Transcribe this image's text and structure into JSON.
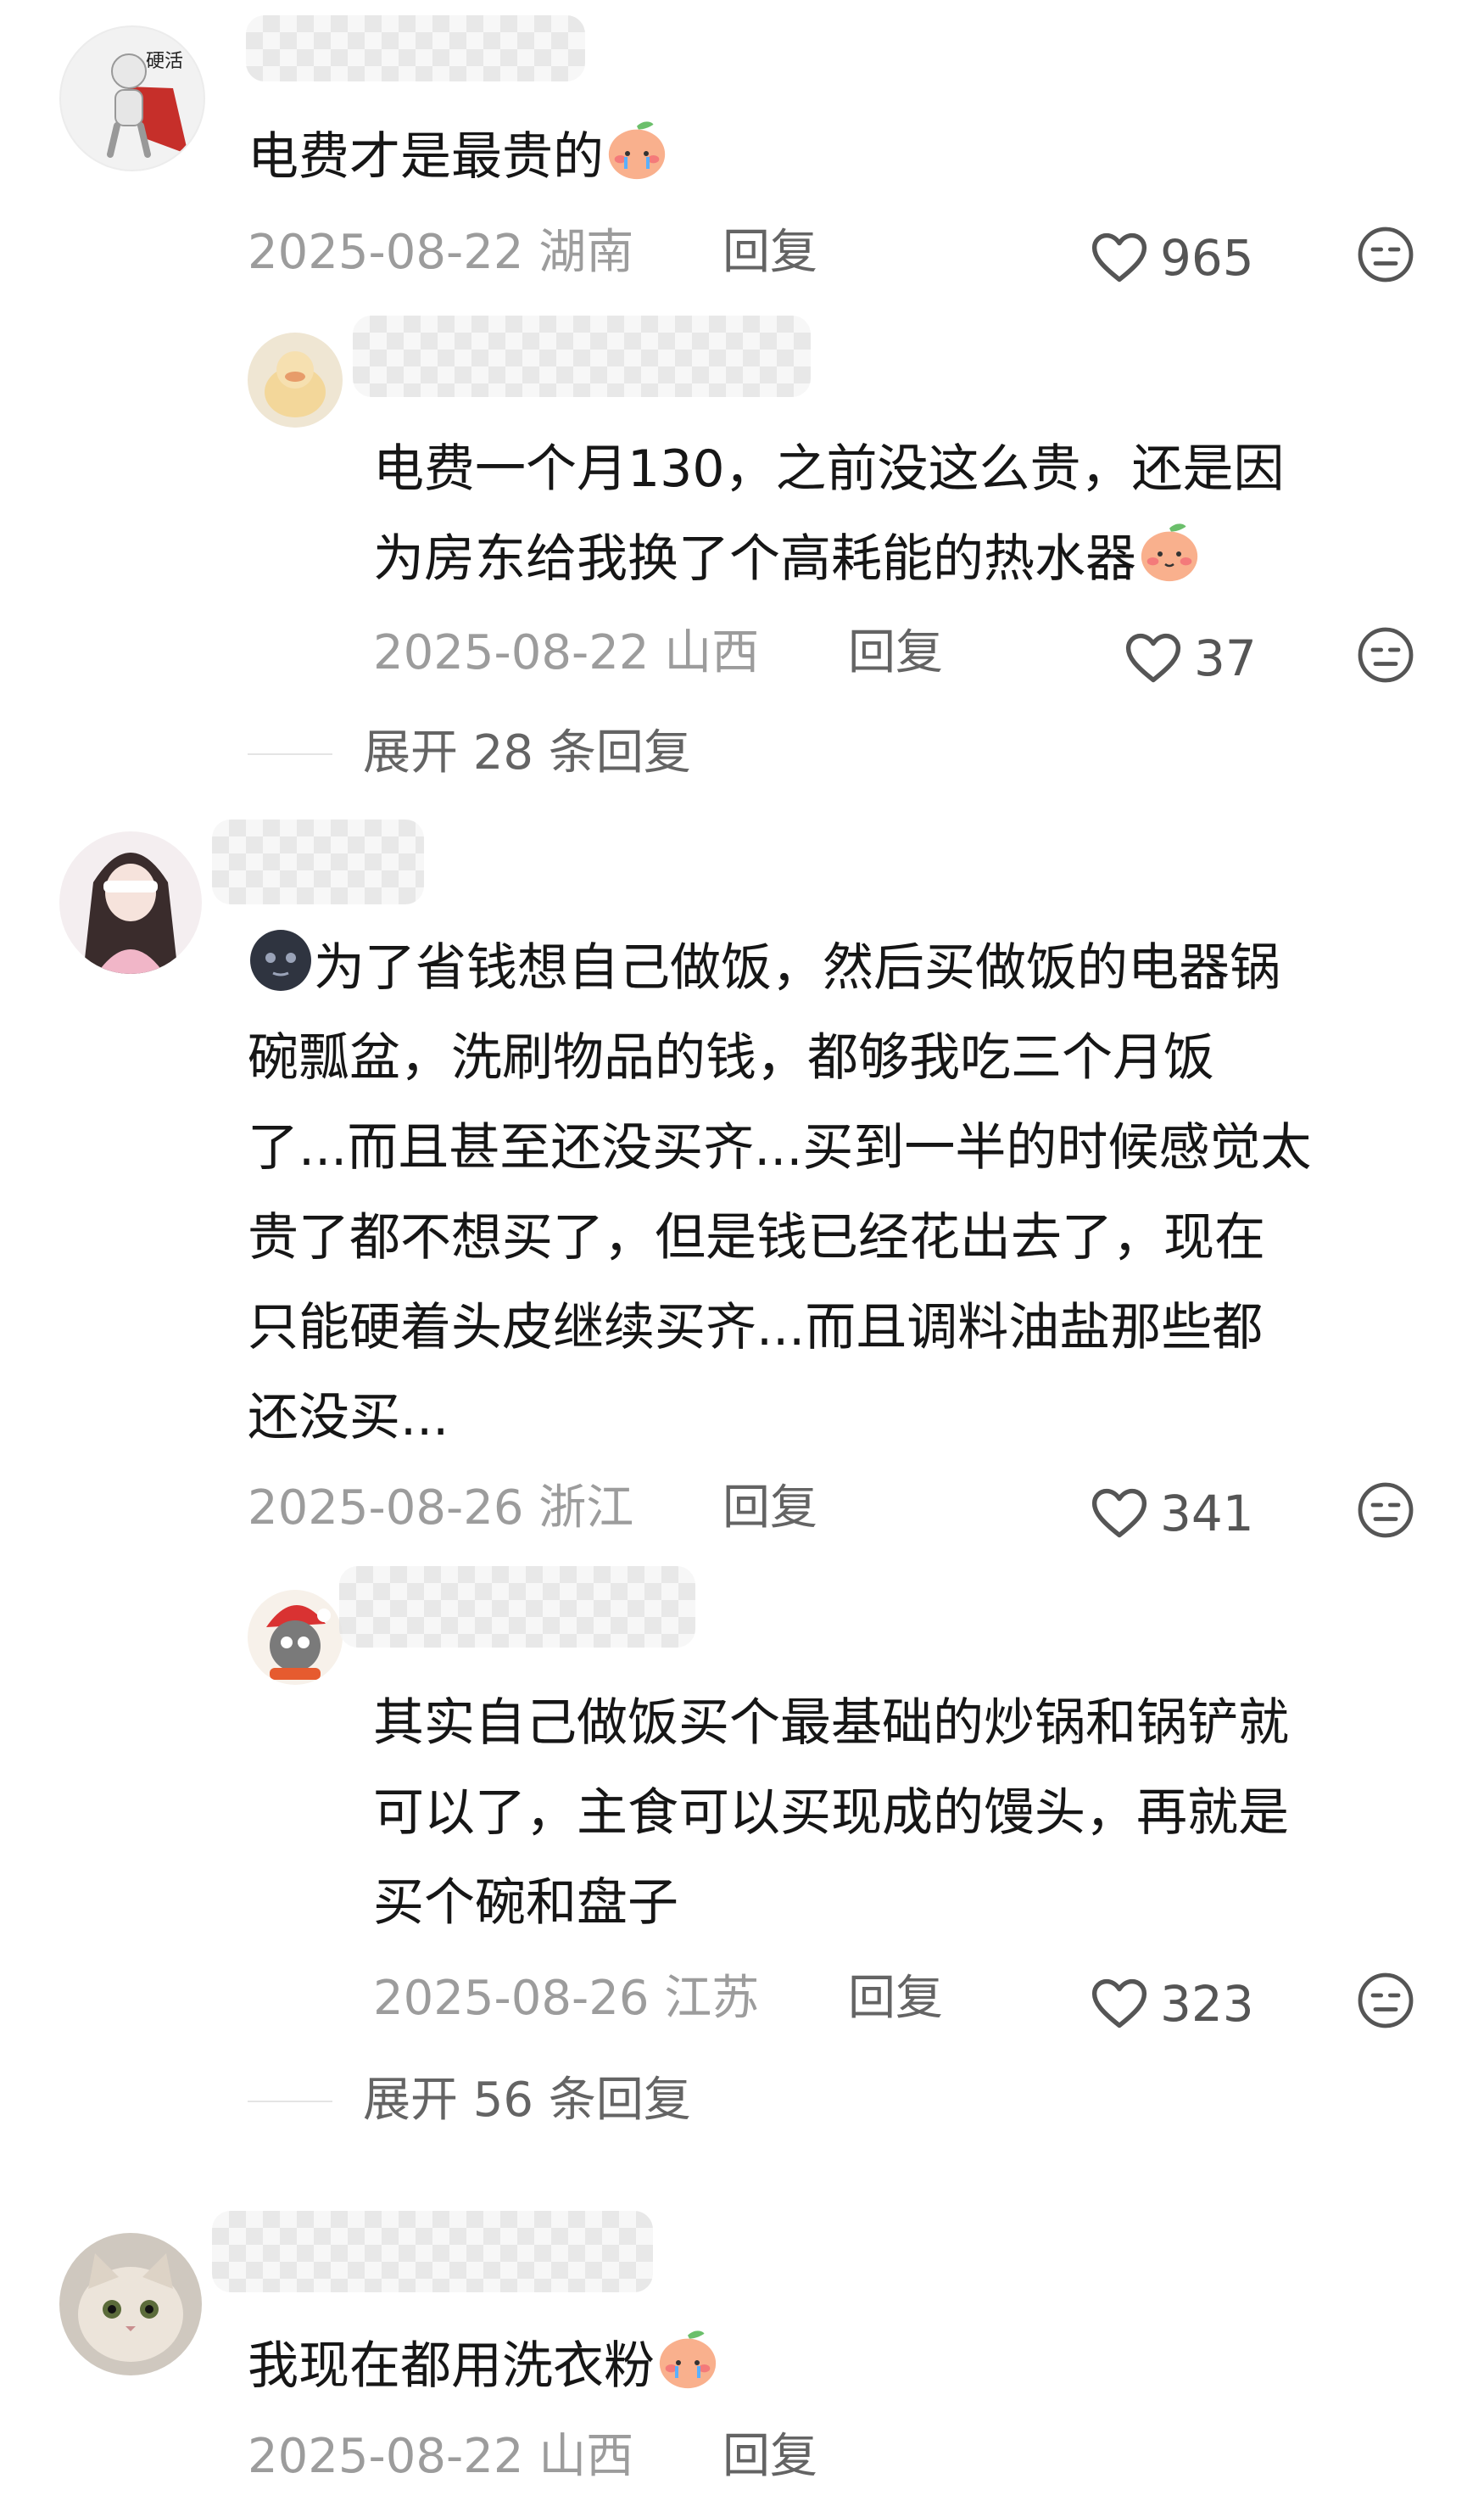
{
  "comments": [
    {
      "text": "电费才是最贵的",
      "date": "2025-08-22",
      "location": "湖南",
      "reply_label": "回复",
      "likes": "965",
      "avatar_text": "硬活",
      "reply": {
        "text_line1": "电费一个月130，之前没这么贵，还是因",
        "text_line2": "为房东给我换了个高耗能的热水器",
        "date": "2025-08-22",
        "location": "山西",
        "reply_label": "回复",
        "likes": "37"
      },
      "expand_label": "展开 28 条回复"
    },
    {
      "lines": [
        "为了省钱想自己做饭，然后买做饭的电器锅",
        "碗瓢盆，洗刷物品的钱，都够我吃三个月饭",
        "了...而且甚至还没买齐...买到一半的时候感觉太",
        "贵了都不想买了，但是钱已经花出去了，现在",
        "只能硬着头皮继续买齐...而且调料油盐那些都",
        "还没买..."
      ],
      "date": "2025-08-26",
      "location": "浙江",
      "reply_label": "回复",
      "likes": "341",
      "reply": {
        "lines": [
          "其实自己做饭买个最基础的炒锅和锅铲就",
          "可以了，主食可以买现成的馒头，再就是",
          "买个碗和盘子"
        ],
        "date": "2025-08-26",
        "location": "江苏",
        "reply_label": "回复",
        "likes": "323"
      },
      "expand_label": "展开 56 条回复"
    },
    {
      "text": "我现在都用洗衣粉",
      "date": "2025-08-22",
      "location": "山西",
      "reply_label": "回复"
    }
  ],
  "icons": {
    "like": "heart-outline-icon",
    "dislike": "meh-face-icon",
    "cry_emoji": "crying-peach-emoji",
    "shy_emoji": "blushing-peach-emoji",
    "moon_emoji": "dark-moon-face-emoji"
  },
  "colors": {
    "text": "#161616",
    "meta": "#9c9c9c",
    "action": "#646464",
    "peach": "#f6a27a"
  }
}
